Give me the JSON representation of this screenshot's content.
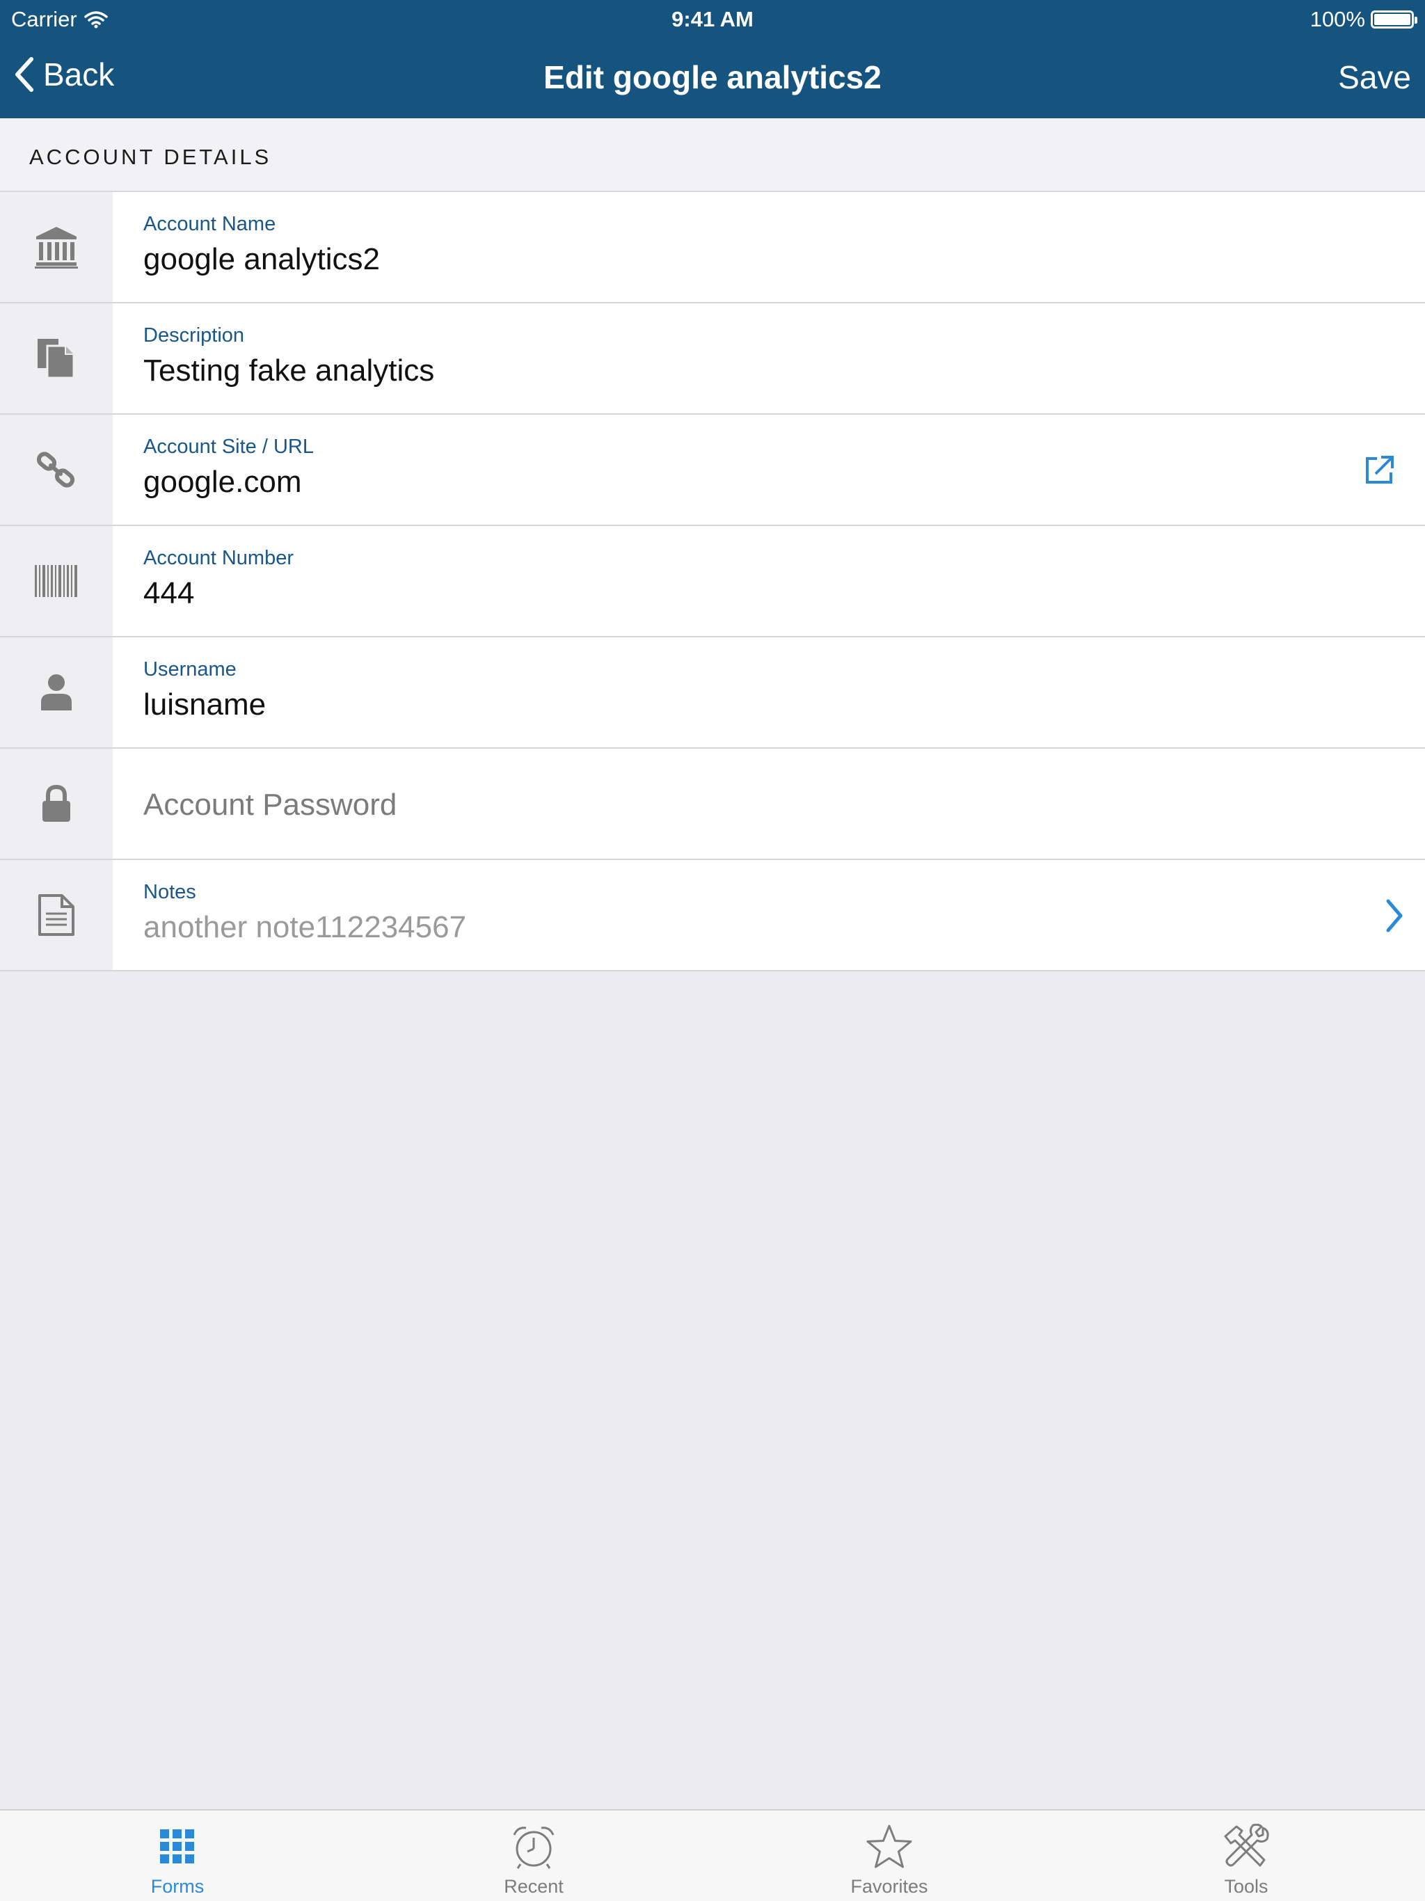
{
  "status_bar": {
    "carrier": "Carrier",
    "time": "9:41 AM",
    "battery": "100%"
  },
  "nav": {
    "back_label": "Back",
    "title": "Edit google analytics2",
    "save_label": "Save"
  },
  "section": {
    "header": "ACCOUNT DETAILS"
  },
  "fields": {
    "account_name": {
      "label": "Account Name",
      "value": "google analytics2",
      "icon": "bank-icon"
    },
    "description": {
      "label": "Description",
      "value": "Testing fake analytics",
      "icon": "documents-icon"
    },
    "url": {
      "label": "Account Site / URL",
      "value": "google.com",
      "icon": "link-icon",
      "action_icon": "external-link-icon"
    },
    "account_number": {
      "label": "Account Number",
      "value": "444",
      "icon": "barcode-icon"
    },
    "username": {
      "label": "Username",
      "value": "luisname",
      "icon": "person-icon"
    },
    "password": {
      "placeholder": "Account Password",
      "icon": "lock-icon"
    },
    "notes": {
      "label": "Notes",
      "value": "another note112234567",
      "icon": "note-icon",
      "action_icon": "chevron-right-icon"
    }
  },
  "tabs": [
    {
      "label": "Forms",
      "icon": "grid-icon",
      "active": true
    },
    {
      "label": "Recent",
      "icon": "alarm-clock-icon",
      "active": false
    },
    {
      "label": "Favorites",
      "icon": "star-icon",
      "active": false
    },
    {
      "label": "Tools",
      "icon": "tools-icon",
      "active": false
    }
  ],
  "colors": {
    "nav_bar": "#165480",
    "label_blue": "#19568a",
    "accent_blue": "#2a8ad8",
    "background": "#ebebf1"
  }
}
